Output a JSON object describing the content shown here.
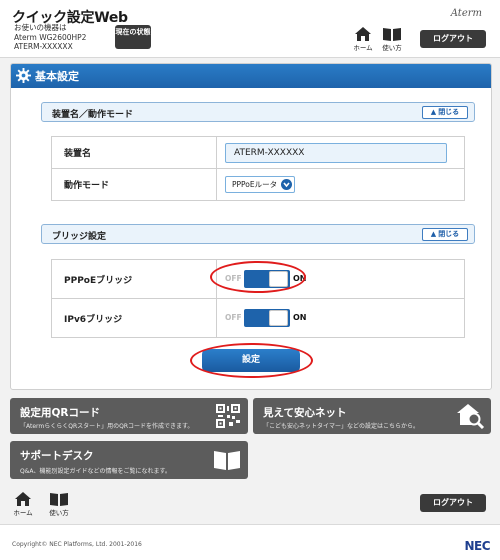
{
  "header": {
    "app_title": "クイック設定Web",
    "device_label": "お使いの機器は",
    "device_model": "Aterm WG2600HP2",
    "device_name": "ATERM-XXXXXX",
    "status_button": "現在の状態",
    "brand_logo": "Aterm",
    "nav_home": "ホーム",
    "nav_manual": "使い方",
    "logout": "ログアウト"
  },
  "panel": {
    "title": "基本設定",
    "sections": {
      "device": {
        "label": "装置名／動作モード",
        "close": "閉じる",
        "rows": {
          "device_name_label": "装置名",
          "device_name_value": "ATERM-XXXXXX",
          "mode_label": "動作モード",
          "mode_value": "PPPoEルータ"
        }
      },
      "bridge": {
        "label": "ブリッジ設定",
        "close": "閉じる",
        "rows": {
          "pppoe_label": "PPPoEブリッジ",
          "ipv6_label": "IPv6ブリッジ",
          "off_text": "OFF",
          "on_text": "ON"
        }
      }
    },
    "submit": "設定"
  },
  "tiles": {
    "qr": {
      "title": "設定用QRコード",
      "desc": "「AtermらくらくQRスタート」用のQRコードを作成できます。"
    },
    "safety": {
      "title": "見えて安心ネット",
      "desc": "「こども安心ネットタイマー」などの設定はこちらから。"
    },
    "support": {
      "title": "サポートデスク",
      "desc": "Q&A、機能別設定ガイドなどの情報をご覧になれます。"
    }
  },
  "footer": {
    "nav_home": "ホーム",
    "nav_manual": "使い方",
    "logout": "ログアウト",
    "copyright": "Copyright© NEC Platforms, Ltd. 2001-2016",
    "brand": "NEC"
  },
  "colors": {
    "accent_blue": "#1e63ab",
    "highlight_red": "#e01c1c",
    "dark_button": "#3a3a3a",
    "tile_gray": "#5c5c5c"
  }
}
